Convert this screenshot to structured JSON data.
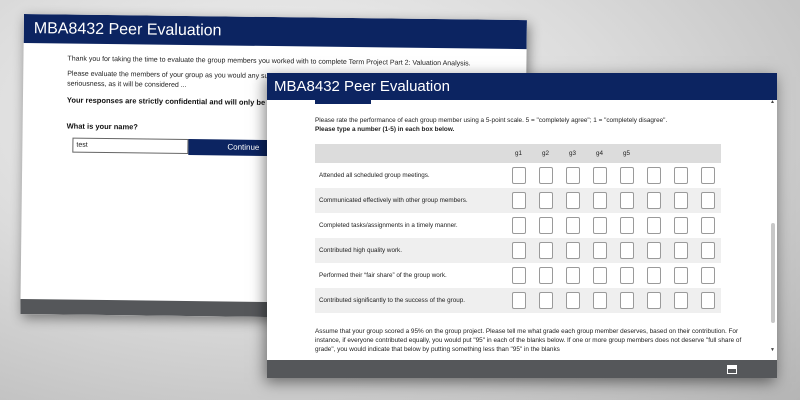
{
  "back_window": {
    "title": "MBA8432 Peer Evaluation",
    "intro": "Thank you for taking the time to evaluate the group members you worked with to complete Term Project Part 2: Valuation Analysis.",
    "instructions": "Please evaluate the members of your group as you would any subordinate, ... The peer evaluation should be undertaken with great care and seriousness, as it will be considered ...",
    "confidential": "Your responses are strictly confidential and will only be see",
    "name_question": "What is your name?",
    "name_value": "test",
    "continue_label": "Continue"
  },
  "front_window": {
    "title": "MBA8432 Peer Evaluation",
    "scale_instruction": "Please rate the performance of each group member using a 5-point scale. 5 = \"completely agree\"; 1 = \"completely disagree\".",
    "number_instruction": "Please type a number (1-5) in each box below.",
    "columns": [
      "g1",
      "g2",
      "g3",
      "g4",
      "g5",
      "",
      "",
      ""
    ],
    "statements": [
      "Attended all scheduled group meetings.",
      "Communicated effectively with other group members.",
      "Completed tasks/assignments in a timely manner.",
      "Contributed high quality work.",
      "Performed their “fair share” of the group work.",
      "Contributed significantly to the success of the group."
    ],
    "grade_paragraph": "Assume that your group scored a 95% on the group project. Please tell me what grade each group member deserves, based on their contribution. For instance, if everyone contributed equally, you would put \"95\" in each of the blanks below. If one or more group members does not deserve \"full share of grade\", you would indicate that below by putting something less than \"95\" in the blanks"
  },
  "icons": {
    "scroll_up": "triangle-up",
    "scroll_down": "triangle-down",
    "footer": "window-expand"
  },
  "colors": {
    "titlebar": "#0c2461",
    "footer": "#55575a",
    "table_header": "#dcdcdc"
  }
}
